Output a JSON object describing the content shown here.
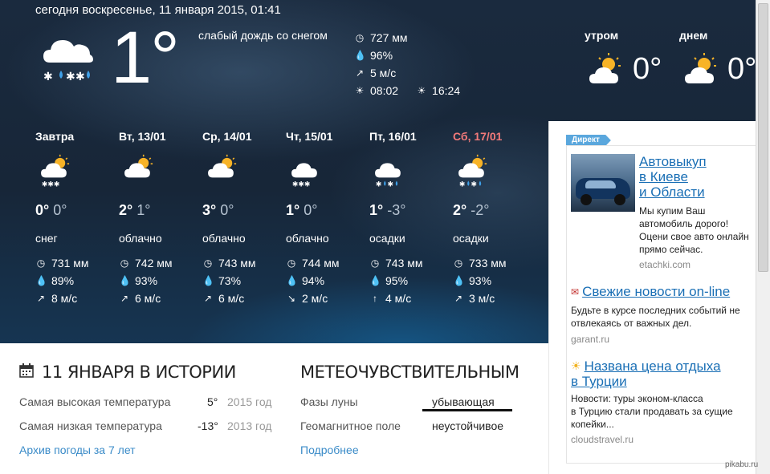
{
  "header": {
    "date_line": "сегодня воскресенье, 11 января 2015, 01:41"
  },
  "current": {
    "icon": "cloud-snow-rain-icon",
    "temp": "1°",
    "description": "слабый дождь со снегом",
    "pressure": "727 мм",
    "humidity": "96%",
    "wind": "5 м/с",
    "sunrise": "08:02",
    "sunset": "16:24"
  },
  "parts": [
    {
      "label": "утром",
      "icon": "partly-cloudy-icon",
      "temp": "0°"
    },
    {
      "label": "днем",
      "icon": "partly-cloudy-icon",
      "temp": "0°"
    }
  ],
  "forecast": [
    {
      "name": "Завтра",
      "weekend": false,
      "icon": "partly-cloudy-snow-icon",
      "day": "0°",
      "night": "0°",
      "cond": "снег",
      "pressure": "731 мм",
      "humidity": "89%",
      "wind": "8 м/с",
      "wind_arrow": "↗"
    },
    {
      "name": "Вт, 13/01",
      "weekend": false,
      "icon": "partly-cloudy-icon",
      "day": "2°",
      "night": "1°",
      "cond": "облачно",
      "pressure": "742 мм",
      "humidity": "93%",
      "wind": "6 м/с",
      "wind_arrow": "↗"
    },
    {
      "name": "Ср, 14/01",
      "weekend": false,
      "icon": "partly-cloudy-icon",
      "day": "3°",
      "night": "0°",
      "cond": "облачно",
      "pressure": "743 мм",
      "humidity": "73%",
      "wind": "6 м/с",
      "wind_arrow": "↗"
    },
    {
      "name": "Чт, 15/01",
      "weekend": false,
      "icon": "cloud-snow-icon",
      "day": "1°",
      "night": "0°",
      "cond": "облачно",
      "pressure": "744 мм",
      "humidity": "94%",
      "wind": "2 м/с",
      "wind_arrow": "↘"
    },
    {
      "name": "Пт, 16/01",
      "weekend": false,
      "icon": "cloud-snow-rain-icon",
      "day": "1°",
      "night": "-3°",
      "cond": "осадки",
      "pressure": "743 мм",
      "humidity": "95%",
      "wind": "4 м/с",
      "wind_arrow": "↑"
    },
    {
      "name": "Сб, 17/01",
      "weekend": true,
      "icon": "partly-cloudy-snow-rain-icon",
      "day": "2°",
      "night": "-2°",
      "cond": "осадки",
      "pressure": "733 мм",
      "humidity": "93%",
      "wind": "3 м/с",
      "wind_arrow": "↗"
    }
  ],
  "ad": {
    "tag": "Директ",
    "items": [
      {
        "title": "Автовыкуп в Киеве и Области",
        "title_lines": [
          "Автовыкуп",
          "в Киеве",
          "и Области"
        ],
        "text": "Мы купим Ваш автомобиль дорого! Оцени свое авто онлайн прямо сейчас.",
        "text_lines": [
          "Мы купим Ваш",
          "автомобиль дорого!",
          "Оцени свое авто онлайн",
          "прямо сейчас."
        ],
        "host": "etachki.com"
      },
      {
        "title": "Свежие новости on-line",
        "text_lines": [
          "Будьте в курсе последних событий не",
          "отвлекаясь от важных дел."
        ],
        "host": "garant.ru"
      },
      {
        "title_lines": [
          "Названа цена отдыха",
          "в Турции"
        ],
        "text_lines": [
          "Новости: туры эконом-класса",
          "в Турцию стали продавать за сущие",
          "копейки..."
        ],
        "host": "cloudstravel.ru"
      }
    ]
  },
  "history": {
    "title": "11 ЯНВАРЯ В ИСТОРИИ",
    "rows": [
      {
        "label": "Самая высокая температура",
        "value": "5°",
        "year": "2015 год"
      },
      {
        "label": "Самая низкая температура",
        "value": "-13°",
        "year": "2013 год"
      }
    ],
    "link": "Архив погоды за 7 лет"
  },
  "meteo": {
    "title": "МЕТЕОЧУВСТВИТЕЛЬНЫМ",
    "rows": [
      {
        "label": "Фазы луны",
        "value": "убывающая"
      },
      {
        "label": "Геомагнитное поле",
        "value": "неустойчивое"
      }
    ],
    "link": "Подробнее"
  },
  "watermark": "pikabu.ru",
  "colors": {
    "weekend": "#f37a7a",
    "link": "#3a8bc8",
    "ad_link": "#1a6fb5",
    "sun": "#f7b327"
  }
}
